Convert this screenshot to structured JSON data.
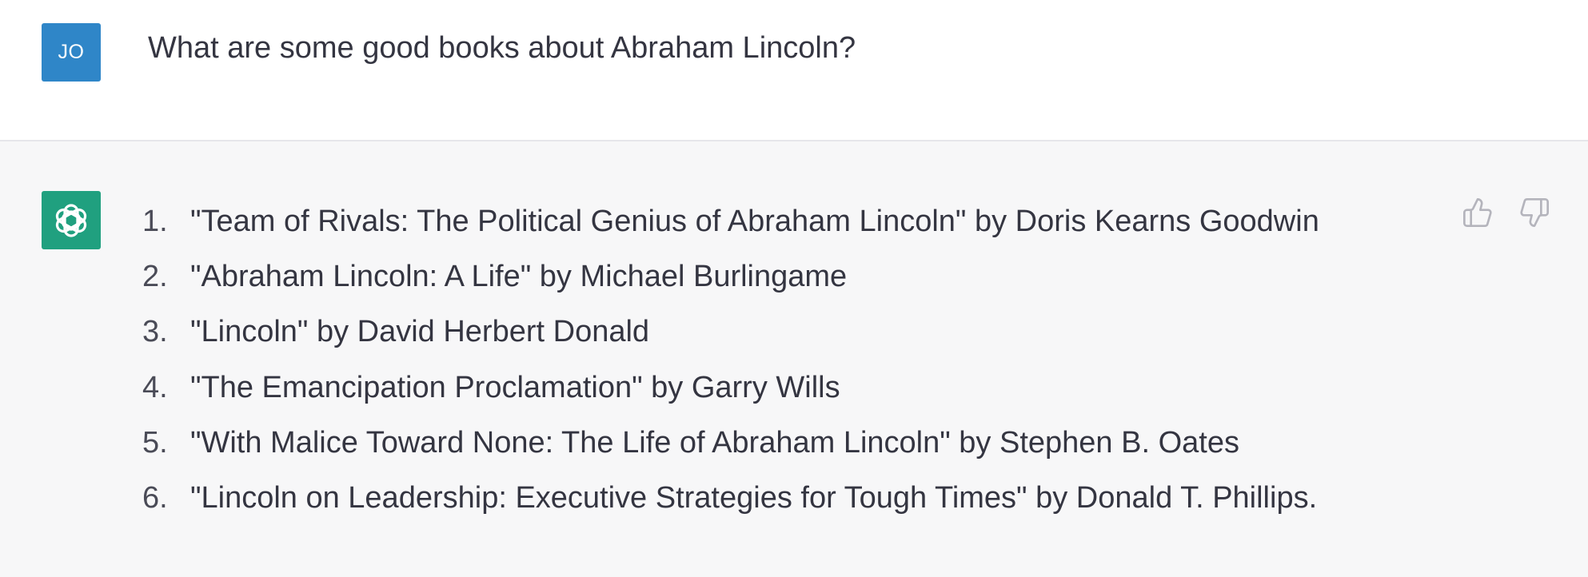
{
  "colors": {
    "user_avatar_bg": "#2f86c8",
    "bot_avatar_bg": "#20a07f",
    "icon_gray": "#b4b4bc"
  },
  "user_message": {
    "avatar_initials": "JO",
    "text": "What are some good books about Abraham Lincoln?"
  },
  "assistant_message": {
    "avatar_icon": "openai-logo-icon",
    "items": [
      {
        "number": "1.",
        "text": "\"Team of Rivals: The Political Genius of Abraham Lincoln\" by Doris Kearns Goodwin"
      },
      {
        "number": "2.",
        "text": "\"Abraham Lincoln: A Life\" by Michael Burlingame"
      },
      {
        "number": "3.",
        "text": "\"Lincoln\" by David Herbert Donald"
      },
      {
        "number": "4.",
        "text": "\"The Emancipation Proclamation\" by Garry Wills"
      },
      {
        "number": "5.",
        "text": "\"With Malice Toward None: The Life of Abraham Lincoln\" by Stephen B. Oates"
      },
      {
        "number": "6.",
        "text": "\"Lincoln on Leadership: Executive Strategies for Tough Times\" by Donald T. Phillips."
      }
    ]
  },
  "feedback_icons": [
    "thumbs-up-icon",
    "thumbs-down-icon"
  ]
}
